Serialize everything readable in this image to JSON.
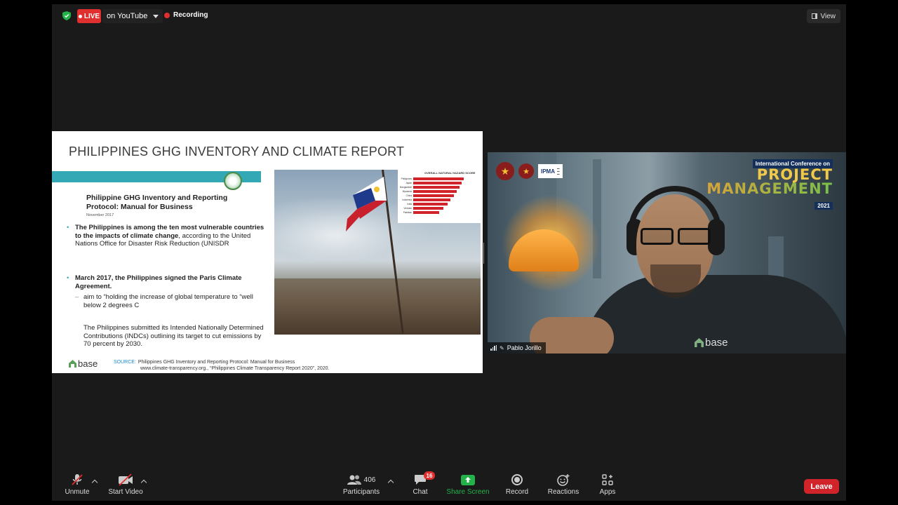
{
  "topbar": {
    "live_label": "LIVE",
    "stream_target": "on YouTube",
    "recording_label": "Recording",
    "view_label": "View"
  },
  "slide": {
    "title": "PHILIPPINES GHG INVENTORY AND CLIMATE REPORT",
    "doc_title": "Philippine GHG Inventory and Reporting Protocol: Manual for Business",
    "doc_date": "November 2017",
    "bullet1_bold": "The Philippines is among the ten most vulnerable countries to the impacts of climate change",
    "bullet1_rest": ", according to the United Nations Office for Disaster Risk Reduction (UNISDR",
    "bullet2_bold": "March 2017, the Philippines signed the Paris Climate Agreement.",
    "sub_bullet": "aim to “holding the increase of global temperature to “well below 2 degrees C",
    "indent_text": "The Philippines submitted its Intended Nationally Determined Contributions (INDCs) outlining its target to cut emissions by 70 percent by 2030.",
    "base_logo": "base",
    "source_label": "SOURCE:",
    "source_text": "Philippines GHG Inventory and Reporting Protocol: Manual for Business",
    "source_url": "www.climate-transparency.org., “Philippines Climate Transparency Report 2020”, 2020.",
    "inset_chart": {
      "title": "OVERALL NATURAL HAZARD SCORE",
      "rows": [
        {
          "label": "Philippines",
          "value": 1.0
        },
        {
          "label": "Japan",
          "value": 0.96
        },
        {
          "label": "Bangladesh",
          "value": 0.92
        },
        {
          "label": "Myanmar",
          "value": 0.86
        },
        {
          "label": "China",
          "value": 0.8
        },
        {
          "label": "Indonesia",
          "value": 0.74
        },
        {
          "label": "India",
          "value": 0.68
        },
        {
          "label": "Vietnam",
          "value": 0.6
        },
        {
          "label": "Pakistan",
          "value": 0.52
        }
      ]
    }
  },
  "speaker": {
    "name": "Pablo Jorillo",
    "conference_header": "International Conference on",
    "conference_title_1": "PROJECT",
    "conference_title_2": "MANAGEMENT",
    "conference_year": "2021",
    "ipma_label": "IPMA",
    "shirt_logo": "base"
  },
  "toolbar": {
    "unmute_label": "Unmute",
    "start_video_label": "Start Video",
    "participants_label": "Participants",
    "participants_count": "406",
    "chat_label": "Chat",
    "chat_badge": "16",
    "share_label": "Share Screen",
    "record_label": "Record",
    "reactions_label": "Reactions",
    "apps_label": "Apps",
    "leave_label": "Leave"
  },
  "colors": {
    "live_red": "#e02f2f",
    "share_green": "#23b24a",
    "teal_accent": "#34a9b5",
    "leave_red": "#d1232a"
  }
}
